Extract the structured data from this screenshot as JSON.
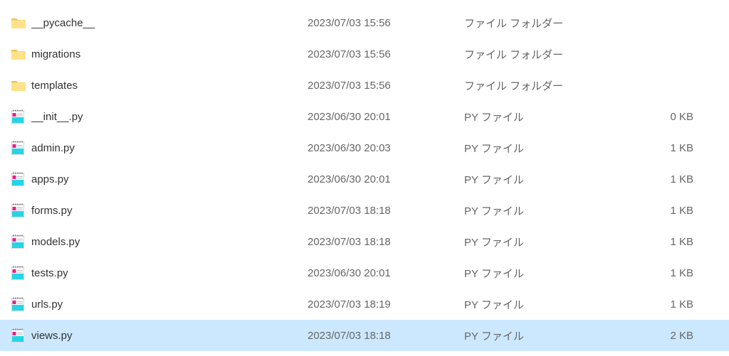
{
  "files": [
    {
      "icon": "folder",
      "name": "__pycache__",
      "date": "2023/07/03 15:56",
      "type": "ファイル フォルダー",
      "size": "",
      "selected": false
    },
    {
      "icon": "folder",
      "name": "migrations",
      "date": "2023/07/03 15:56",
      "type": "ファイル フォルダー",
      "size": "",
      "selected": false
    },
    {
      "icon": "folder",
      "name": "templates",
      "date": "2023/07/03 15:56",
      "type": "ファイル フォルダー",
      "size": "",
      "selected": false
    },
    {
      "icon": "pyfile",
      "name": "__init__.py",
      "date": "2023/06/30 20:01",
      "type": "PY ファイル",
      "size": "0 KB",
      "selected": false
    },
    {
      "icon": "pyfile",
      "name": "admin.py",
      "date": "2023/06/30 20:03",
      "type": "PY ファイル",
      "size": "1 KB",
      "selected": false
    },
    {
      "icon": "pyfile",
      "name": "apps.py",
      "date": "2023/06/30 20:01",
      "type": "PY ファイル",
      "size": "1 KB",
      "selected": false
    },
    {
      "icon": "pyfile",
      "name": "forms.py",
      "date": "2023/07/03 18:18",
      "type": "PY ファイル",
      "size": "1 KB",
      "selected": false
    },
    {
      "icon": "pyfile",
      "name": "models.py",
      "date": "2023/07/03 18:18",
      "type": "PY ファイル",
      "size": "1 KB",
      "selected": false
    },
    {
      "icon": "pyfile",
      "name": "tests.py",
      "date": "2023/06/30 20:01",
      "type": "PY ファイル",
      "size": "1 KB",
      "selected": false
    },
    {
      "icon": "pyfile",
      "name": "urls.py",
      "date": "2023/07/03 18:19",
      "type": "PY ファイル",
      "size": "1 KB",
      "selected": false
    },
    {
      "icon": "pyfile",
      "name": "views.py",
      "date": "2023/07/03 18:18",
      "type": "PY ファイル",
      "size": "2 KB",
      "selected": true
    }
  ],
  "icons": {
    "folder": "folder-icon",
    "pyfile": "pyfile-icon"
  }
}
